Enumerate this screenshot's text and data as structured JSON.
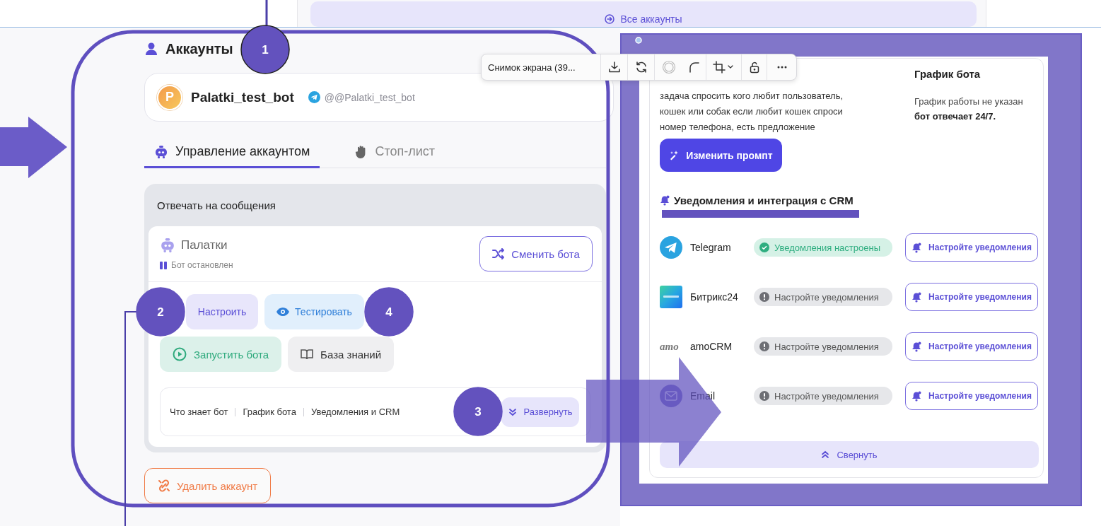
{
  "top_bar": {
    "all_accounts_button": "Все аккаунты"
  },
  "accounts": {
    "title": "Аккаунты",
    "bot": {
      "avatar_letter": "P",
      "name": "Palatki_test_bot",
      "handle": "@@Palatki_test_bot"
    },
    "tabs": [
      {
        "label": "Управление аккаунтом",
        "kind": "manage",
        "selected": true
      },
      {
        "label": "Стоп-лист",
        "kind": "stoplist",
        "selected": false
      }
    ],
    "section_title": "Отвечать на сообщения",
    "bot_card": {
      "name": "Палатки",
      "status": "Бот остановлен",
      "switch_button": "Сменить бота"
    },
    "actions": [
      {
        "label": "Настроить",
        "kind": "configure"
      },
      {
        "label": "Тестировать",
        "kind": "test"
      },
      {
        "label": "Запустить бота",
        "kind": "start"
      },
      {
        "label": "База знаний",
        "kind": "knowledge"
      }
    ],
    "summary_links": [
      "Что знает бот",
      "График бота",
      "Уведомления и CRM"
    ],
    "expand_button": "Развернуть",
    "delete_button": "Удалить аккаунт"
  },
  "screenshot_toolbar": {
    "title": "Снимок экрана (39..."
  },
  "expanded_view": {
    "prompt_text": "задача спросить кого любит пользователь, кошек или собак если любит кошек спроси номер телефона, есть предложение",
    "edit_prompt_button": "Изменить промпт",
    "schedule": {
      "title": "График бота",
      "text": "График работы не указан",
      "note": "бот отвечает 24/7."
    },
    "notifications_title": "Уведомления и интеграция с CRM",
    "integrations": [
      {
        "name": "Telegram",
        "kind": "telegram",
        "status": "Уведомления настроены",
        "configured": true,
        "button": "Настройте уведомления"
      },
      {
        "name": "Битрикс24",
        "kind": "bitrix",
        "status": "Настройте уведомления",
        "configured": false,
        "button": "Настройте уведомления"
      },
      {
        "name": "amoCRM",
        "kind": "amo",
        "logo_text": "amo",
        "status": "Настройте уведомления",
        "configured": false,
        "button": "Настройте уведомления"
      },
      {
        "name": "Email",
        "kind": "email",
        "status": "Настройте уведомления",
        "configured": false,
        "button": "Настройте уведомления"
      }
    ],
    "collapse_button": "Свернуть"
  },
  "annotations": [
    {
      "number": "1"
    },
    {
      "number": "2"
    },
    {
      "number": "3"
    },
    {
      "number": "4"
    }
  ]
}
